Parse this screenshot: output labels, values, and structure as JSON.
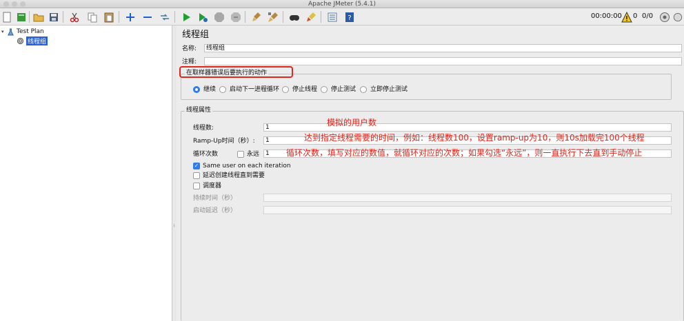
{
  "window": {
    "title": "Apache JMeter (5.4.1)"
  },
  "toolbar": {
    "elapsed": "00:00:00",
    "warnings": "0",
    "threads": "0/0",
    "icons": [
      "new-icon",
      "templates-icon",
      "open-icon",
      "save-icon",
      "cut-icon",
      "copy-icon",
      "paste-icon",
      "expand-icon",
      "collapse-icon",
      "toggle-icon",
      "start-icon",
      "start-no-pause-icon",
      "stop-icon",
      "shutdown-icon",
      "clear-icon",
      "clear-all-icon",
      "search-icon",
      "reset-search-icon",
      "function-helper-icon",
      "help-icon",
      "warning-icon",
      "remote-icon"
    ]
  },
  "tree": {
    "items": [
      {
        "label": "Test Plan"
      },
      {
        "label": "线程组"
      }
    ]
  },
  "thread_group": {
    "heading": "线程组",
    "name_label": "名称:",
    "name_value": "线程组",
    "comment_label": "注释:",
    "comment_value": "",
    "error_action": {
      "title": "在取样器错误后要执行的动作",
      "options": [
        "继续",
        "启动下一进程循环",
        "停止线程",
        "停止测试",
        "立即停止测试"
      ],
      "selected": "继续"
    },
    "properties": {
      "title": "线程属性",
      "threads_label": "线程数:",
      "threads_value": "1",
      "rampup_label": "Ramp-Up时间（秒）:",
      "rampup_value": "1",
      "loop_label": "循环次数",
      "forever_label": "永远",
      "loop_value": "1",
      "same_user_label": "Same user on each iteration",
      "delay_label": "延迟创建线程直到需要",
      "scheduler_label": "调度器",
      "duration_label": "持续时间（秒）",
      "startup_delay_label": "启动延迟（秒）"
    }
  },
  "annotations": {
    "threads_note": "模拟的用户数",
    "rampup_note": "达到指定线程需要的时间，例如：线程数100，设置ramp-up为10，则10s加载完100个线程",
    "loop_note": "循环次数，填写对应的数值，就循环对应的次数；如果勾选“永远”，则一直执行下去直到手动停止",
    "color": "#e4251b"
  },
  "colors": {
    "accent": "#2f7bf6",
    "selection": "#2b5fd8",
    "annotation": "#e4251b"
  }
}
